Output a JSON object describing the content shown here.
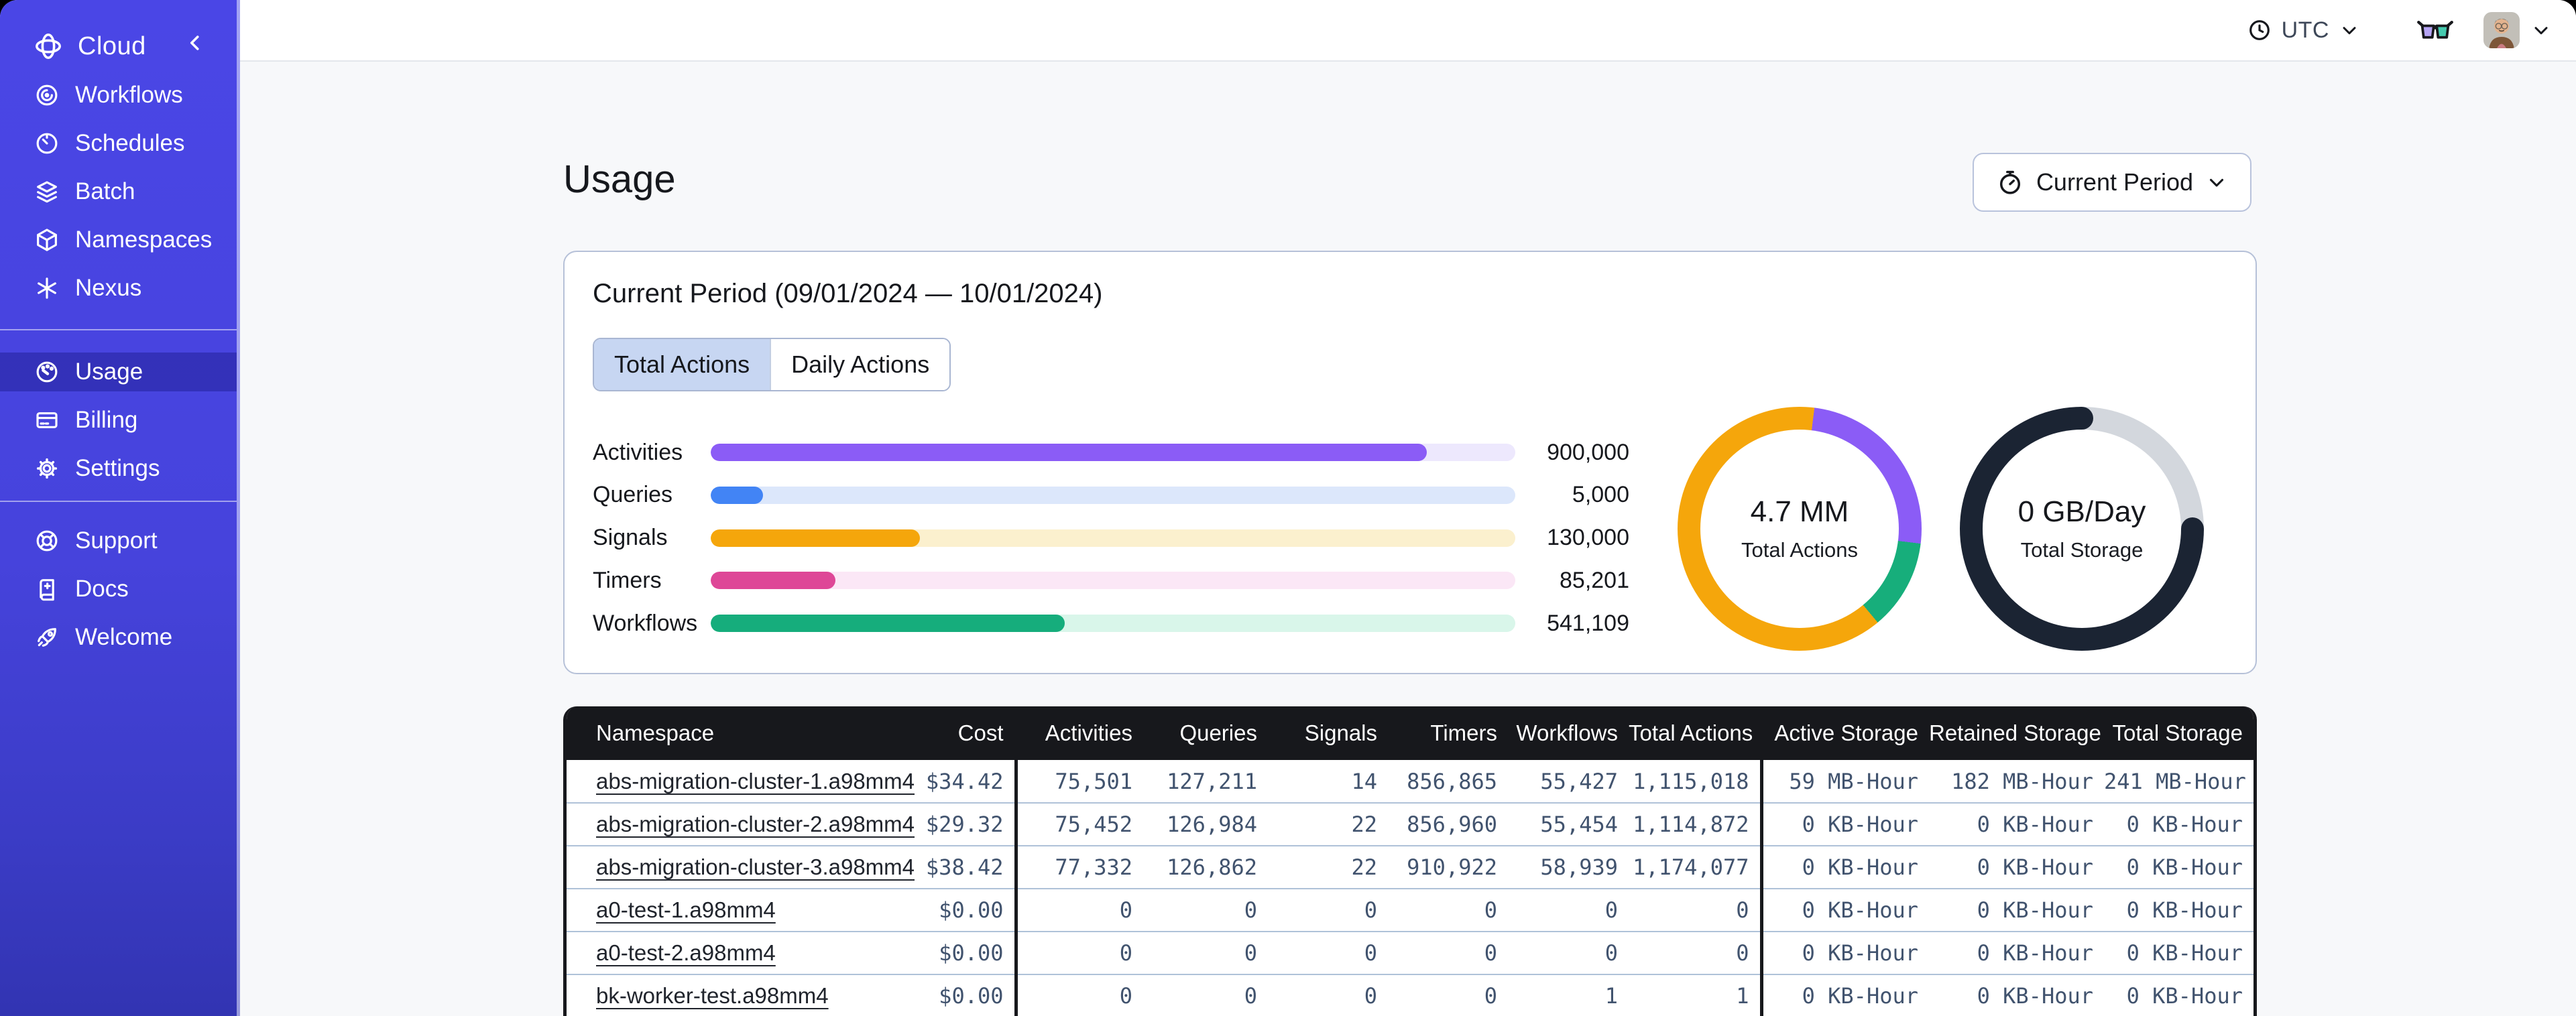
{
  "sidebar": {
    "brand": "Cloud",
    "groups": [
      {
        "items": [
          {
            "label": "Workflows",
            "icon": "workflows"
          },
          {
            "label": "Schedules",
            "icon": "schedules"
          },
          {
            "label": "Batch",
            "icon": "batch"
          },
          {
            "label": "Namespaces",
            "icon": "namespaces"
          },
          {
            "label": "Nexus",
            "icon": "nexus"
          }
        ]
      },
      {
        "items": [
          {
            "label": "Usage",
            "icon": "usage",
            "active": true
          },
          {
            "label": "Billing",
            "icon": "billing"
          },
          {
            "label": "Settings",
            "icon": "settings"
          }
        ]
      },
      {
        "items": [
          {
            "label": "Support",
            "icon": "support"
          },
          {
            "label": "Docs",
            "icon": "docs"
          },
          {
            "label": "Welcome",
            "icon": "welcome"
          }
        ]
      }
    ]
  },
  "topbar": {
    "timezone": "UTC",
    "icons": [
      "clock",
      "chevron-down",
      "reader-glasses",
      "avatar",
      "chevron-down"
    ]
  },
  "page": {
    "title": "Usage",
    "period_selector": "Current Period"
  },
  "usage_card": {
    "title": "Current Period (09/01/2024 — 10/01/2024)",
    "tabs": [
      {
        "label": "Total Actions",
        "active": true
      },
      {
        "label": "Daily Actions",
        "active": false
      }
    ]
  },
  "chart_data": [
    {
      "type": "bar",
      "title": "Total Actions by type",
      "categories": [
        "Activities",
        "Queries",
        "Signals",
        "Timers",
        "Workflows"
      ],
      "values": [
        900000,
        5000,
        130000,
        85201,
        541109
      ],
      "value_labels": [
        "900,000",
        "5,000",
        "130,000",
        "85,201",
        "541,109"
      ],
      "fill_pct": [
        89,
        6.5,
        26,
        15.5,
        44
      ],
      "colors": [
        "#8B5CF6",
        "#4284F5",
        "#F5A60B",
        "#DE4797",
        "#16AD7C"
      ],
      "track_colors": [
        "#EDE8FD",
        "#DCE7FB",
        "#FBF0CE",
        "#FBE7F6",
        "#D9F6EA"
      ],
      "grid": false,
      "legend": false
    },
    {
      "type": "donut",
      "center_value": "4.7 MM",
      "center_label": "Total Actions",
      "from_deg": 7,
      "segments": [
        {
          "color": "#8B5CF6",
          "end_pct": 25
        },
        {
          "color": "#17AE7B",
          "end_pct": 37
        },
        {
          "color": "#F5A60B",
          "end_pct": 100
        }
      ]
    },
    {
      "type": "donut",
      "center_value": "0 GB/Day",
      "center_label": "Total Storage",
      "from_deg": 0,
      "segments": [
        {
          "color": "#D3D7DD",
          "end_pct": 25
        },
        {
          "color": "#1B2433",
          "end_pct": 100
        }
      ],
      "caps": [
        {
          "pos": 0,
          "color": "#1B2433"
        },
        {
          "pos": 0.25,
          "color": "#1B2433"
        }
      ]
    }
  ],
  "table": {
    "headers": [
      "Namespace",
      "Cost",
      "Activities",
      "Queries",
      "Signals",
      "Timers",
      "Workflows",
      "Total Actions",
      "Active Storage",
      "Retained Storage",
      "Total Storage"
    ],
    "rows": [
      [
        "abs-migration-cluster-1.a98mm4",
        "$34.42",
        "75,501",
        "127,211",
        "14",
        "856,865",
        "55,427",
        "1,115,018",
        "59 MB-Hour",
        "182 MB-Hour",
        "241 MB-Hour"
      ],
      [
        "abs-migration-cluster-2.a98mm4",
        "$29.32",
        "75,452",
        "126,984",
        "22",
        "856,960",
        "55,454",
        "1,114,872",
        "0 KB-Hour",
        "0 KB-Hour",
        "0 KB-Hour"
      ],
      [
        "abs-migration-cluster-3.a98mm4",
        "$38.42",
        "77,332",
        "126,862",
        "22",
        "910,922",
        "58,939",
        "1,174,077",
        "0 KB-Hour",
        "0 KB-Hour",
        "0 KB-Hour"
      ],
      [
        "a0-test-1.a98mm4",
        "$0.00",
        "0",
        "0",
        "0",
        "0",
        "0",
        "0",
        "0 KB-Hour",
        "0 KB-Hour",
        "0 KB-Hour"
      ],
      [
        "a0-test-2.a98mm4",
        "$0.00",
        "0",
        "0",
        "0",
        "0",
        "0",
        "0",
        "0 KB-Hour",
        "0 KB-Hour",
        "0 KB-Hour"
      ],
      [
        "bk-worker-test.a98mm4",
        "$0.00",
        "0",
        "0",
        "0",
        "0",
        "1",
        "1",
        "0 KB-Hour",
        "0 KB-Hour",
        "0 KB-Hour"
      ]
    ]
  },
  "colors": {
    "sidebar_top": "#4A46E6",
    "sidebar_bottom": "#3234B2",
    "sidebar_active": "#3E3BC4",
    "table_header_bg": "#17181C",
    "table_number_text": "#41536E",
    "card_border": "#B6C1D8",
    "content_bg": "#F7F8FA",
    "glasses_left_lens": "#B5A3F4",
    "glasses_right_lens": "#46CBB0"
  }
}
